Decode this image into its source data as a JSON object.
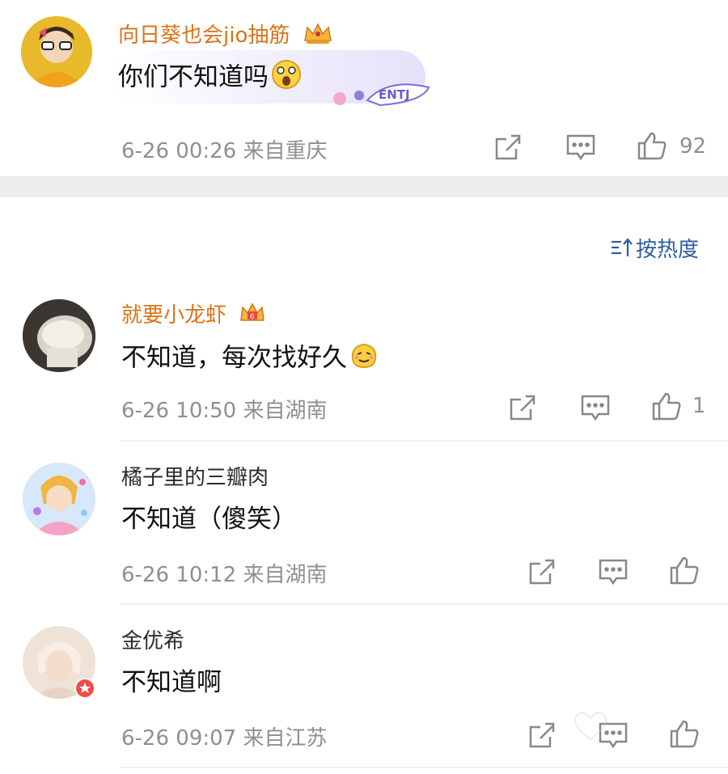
{
  "comments": [
    {
      "username": "向日葵也会jio抽筋",
      "text": "你们不知道吗",
      "date": "6-26 00:26",
      "location": "来自重庆",
      "likes": "92",
      "vip": true,
      "badge": "ENTJ"
    },
    {
      "username": "就要小龙虾",
      "text": "不知道，每次找好久",
      "date": "6-26 10:50",
      "location": "来自湖南",
      "likes": "1",
      "vip": true
    },
    {
      "username": "橘子里的三瓣肉",
      "text": "不知道（傻笑）",
      "date": "6-26 10:12",
      "location": "来自湖南",
      "likes": "",
      "vip": false
    },
    {
      "username": "金优希",
      "text": "不知道啊",
      "date": "6-26 09:07",
      "location": "来自江苏",
      "likes": "",
      "vip": false
    }
  ],
  "sort": {
    "label": "按热度"
  },
  "icons": {
    "share": "share-icon",
    "comment": "comment-icon",
    "like": "thumbs-up-icon",
    "crown": "crown-badge-icon",
    "sort": "sort-icon"
  },
  "colors": {
    "vip_name": "#d9731a",
    "sort_link": "#2f5da3",
    "meta": "#8f8f8f",
    "divider": "#eeeeee"
  }
}
